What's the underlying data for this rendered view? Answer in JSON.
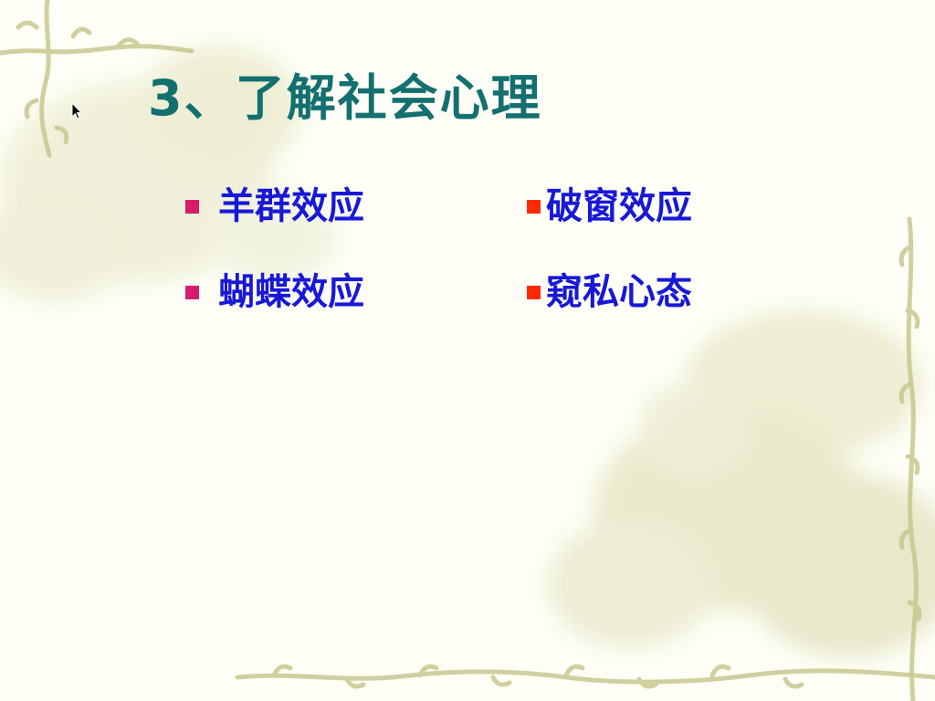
{
  "slide": {
    "title": "3、了解社会心理",
    "bullets": [
      {
        "text": "羊群效应",
        "bullet_color": "#d81c6c"
      },
      {
        "text": "破窗效应",
        "bullet_color": "#ff2a00"
      },
      {
        "text": "蝴蝶效应",
        "bullet_color": "#d81c6c"
      },
      {
        "text": "窥私心态",
        "bullet_color": "#ff2a00"
      }
    ]
  },
  "theme": {
    "title_color": "#13706f",
    "text_color": "#1818d8",
    "background_color": "#fefef6",
    "vine_color": "#c8c890"
  },
  "icons": {
    "cursor": "arrow-cursor-icon",
    "bullet": "square-bullet-icon"
  }
}
